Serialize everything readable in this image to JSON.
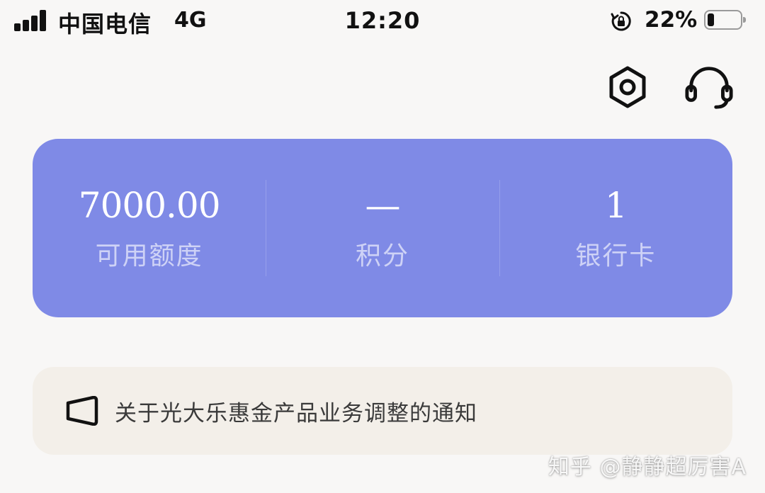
{
  "status_bar": {
    "carrier": "中国电信",
    "network": "4G",
    "time": "12:20",
    "battery_percent_text": "22%",
    "battery_level": 0.22,
    "icons": [
      "signal-icon",
      "rotation-lock-icon",
      "battery-icon"
    ]
  },
  "header": {
    "icons": {
      "settings": "settings-hexagon-icon",
      "support": "headset-icon"
    }
  },
  "summary": {
    "items": [
      {
        "value": "7000.00",
        "label": "可用额度"
      },
      {
        "value": "—",
        "label": "积分"
      },
      {
        "value": "1",
        "label": "银行卡"
      }
    ],
    "card_color": "#7f8ae6"
  },
  "notice": {
    "icon": "megaphone-icon",
    "text": "关于光大乐惠金产品业务调整的通知"
  },
  "watermark": {
    "text": "知乎 @静静超厉害A"
  }
}
